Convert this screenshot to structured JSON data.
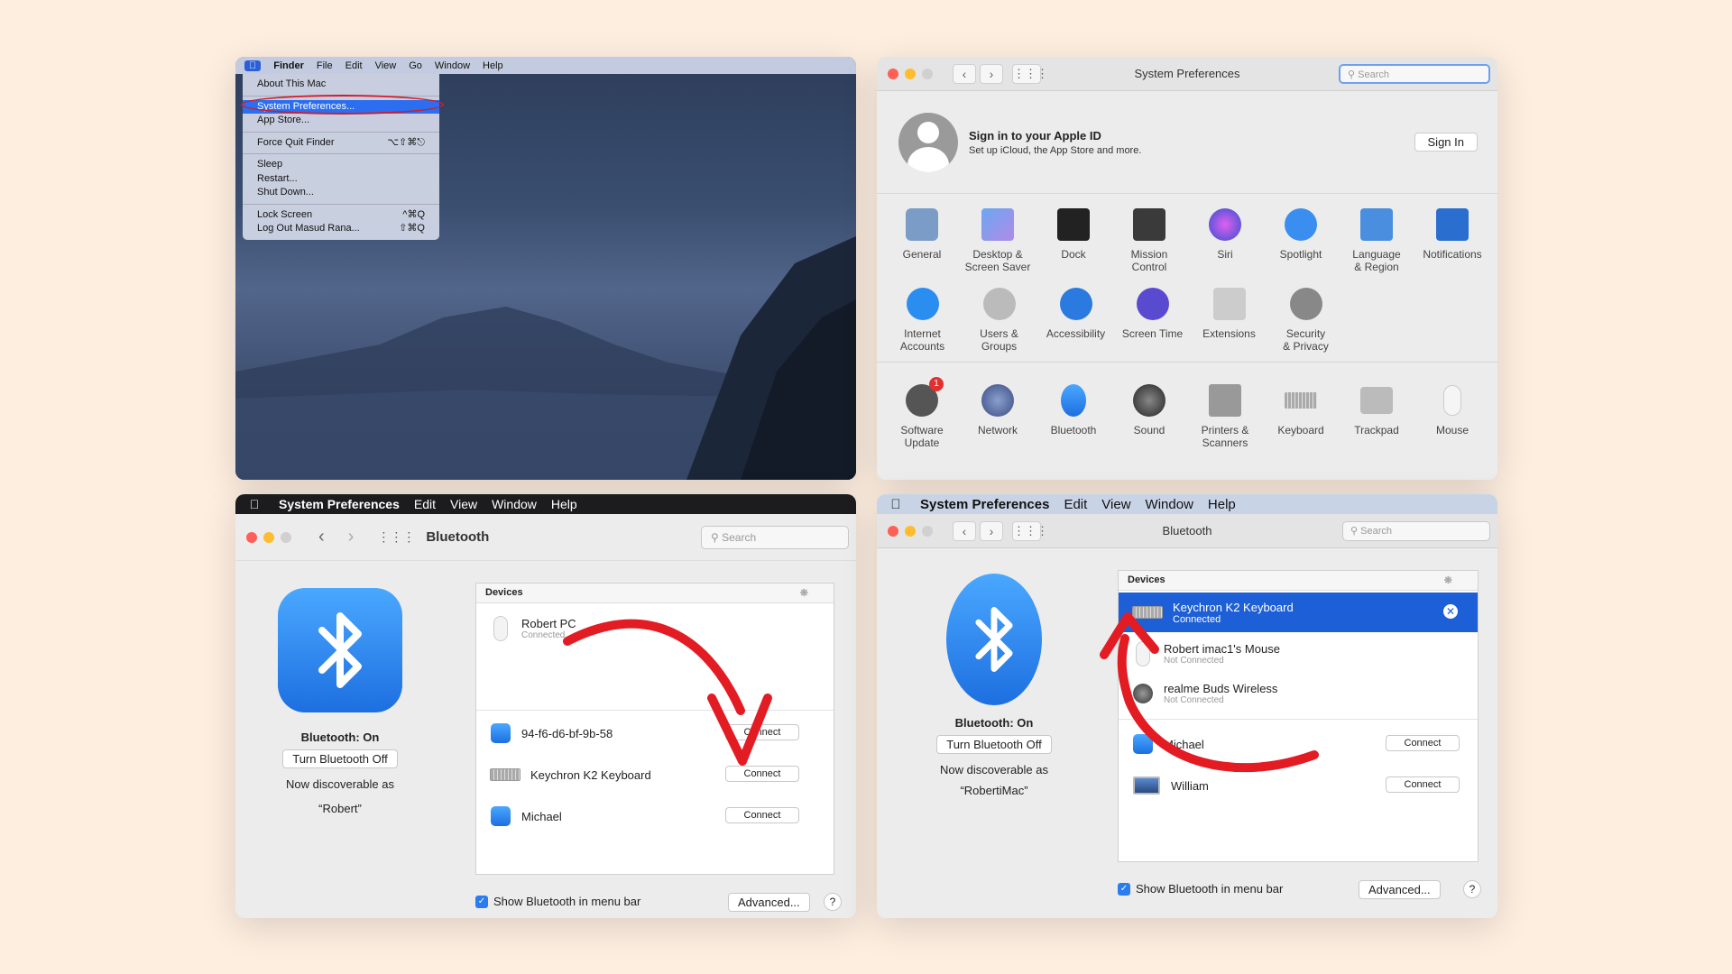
{
  "p1": {
    "menubar": {
      "apple": "",
      "items": [
        "Finder",
        "File",
        "Edit",
        "View",
        "Go",
        "Window",
        "Help"
      ]
    },
    "menu": {
      "about": "About This Mac",
      "sysprefs": "System Preferences...",
      "appstore": "App Store...",
      "forcequit": "Force Quit Finder",
      "forcequit_sc": "⌥⇧⌘⎋",
      "sleep": "Sleep",
      "restart": "Restart...",
      "shutdown": "Shut Down...",
      "lock": "Lock Screen",
      "lock_sc": "^⌘Q",
      "logout": "Log Out Masud Rana...",
      "logout_sc": "⇧⌘Q"
    }
  },
  "p2": {
    "title": "System Preferences",
    "search_placeholder": "Search",
    "signin": {
      "title": "Sign in to your Apple ID",
      "sub": "Set up iCloud, the App Store and more.",
      "button": "Sign In"
    },
    "row1": [
      "General",
      "Desktop &\nScreen Saver",
      "Dock",
      "Mission\nControl",
      "Siri",
      "Spotlight",
      "Language\n& Region",
      "Notifications"
    ],
    "row2": [
      "Internet\nAccounts",
      "Users &\nGroups",
      "Accessibility",
      "Screen Time",
      "Extensions",
      "Security\n& Privacy"
    ],
    "row3": [
      "Software\nUpdate",
      "Network",
      "Bluetooth",
      "Sound",
      "Printers &\nScanners",
      "Keyboard",
      "Trackpad",
      "Mouse"
    ],
    "badge": "1",
    "icons": {
      "row1": [
        "general-icon",
        "desktop-icon",
        "dock-icon",
        "mission-control-icon",
        "siri-icon",
        "spotlight-icon",
        "language-icon",
        "notifications-icon"
      ],
      "row2": [
        "internet-accounts-icon",
        "users-icon",
        "accessibility-icon",
        "screen-time-icon",
        "extensions-icon",
        "security-icon"
      ],
      "row3": [
        "software-update-icon",
        "network-icon",
        "bluetooth-icon",
        "sound-icon",
        "printer-icon",
        "keyboard-icon",
        "trackpad-icon",
        "mouse-icon"
      ]
    }
  },
  "p3": {
    "menubar": [
      "System Preferences",
      "Edit",
      "View",
      "Window",
      "Help"
    ],
    "title": "Bluetooth",
    "search_placeholder": "Search",
    "status": "Bluetooth: On",
    "toggle": "Turn Bluetooth Off",
    "discover": "Now discoverable as",
    "name": "“Robert”",
    "devices_header": "Devices",
    "dev1": {
      "name": "Robert PC",
      "sub": "Connected"
    },
    "dev2": {
      "name": "94-f6-d6-bf-9b-58",
      "btn": "Connect"
    },
    "dev3": {
      "name": "Keychron K2 Keyboard",
      "btn": "Connect"
    },
    "dev4": {
      "name": "Michael",
      "btn": "Connect"
    },
    "show_menu": "Show Bluetooth in menu bar",
    "advanced": "Advanced...",
    "help": "?"
  },
  "p4": {
    "menubar": [
      "System Preferences",
      "Edit",
      "View",
      "Window",
      "Help"
    ],
    "title": "Bluetooth",
    "search_placeholder": "Search",
    "status": "Bluetooth: On",
    "toggle": "Turn Bluetooth Off",
    "discover": "Now discoverable as",
    "name": "“RobertiMac”",
    "devices_header": "Devices",
    "dev1": {
      "name": "Keychron K2 Keyboard",
      "sub": "Connected"
    },
    "dev2": {
      "name": "Robert imac1's Mouse",
      "sub": "Not Connected"
    },
    "dev3": {
      "name": "realme Buds Wireless",
      "sub": "Not Connected"
    },
    "dev4": {
      "name": "Michael",
      "btn": "Connect"
    },
    "dev5": {
      "name": "William",
      "btn": "Connect"
    },
    "show_menu": "Show Bluetooth in menu bar",
    "advanced": "Advanced...",
    "help": "?"
  },
  "colors": {
    "arrow": "#e31b23",
    "selection": "#1d5fd6",
    "background": "#fdeee0"
  }
}
